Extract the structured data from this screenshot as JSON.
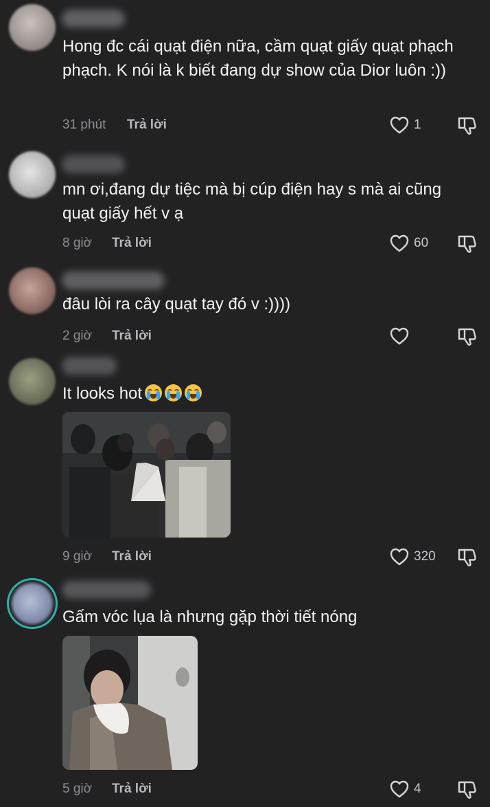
{
  "comments": [
    {
      "text": "Hong đc cái quạt điện nữa, cầm quạt giấy quạt phạch phạch. K nói là k biết đang dự show của Dior luôn :))",
      "time": "31 phút",
      "reply_label": "Trả lời",
      "likes": "1"
    },
    {
      "text": "mn ơi,đang dự tiệc mà bị cúp điện hay s mà ai cũng quạt giấy hết v ạ",
      "time": "8 giờ",
      "reply_label": "Trả lời",
      "likes": "60"
    },
    {
      "text": "đâu lòi ra cây quạt tay đó v :))))",
      "time": "2 giờ",
      "reply_label": "Trả lời",
      "likes": ""
    },
    {
      "text": "It looks hot",
      "time": "9 giờ",
      "reply_label": "Trả lời",
      "likes": "320",
      "emoji": "loudly-crying-face x3"
    },
    {
      "text": "Gấm vóc lụa là nhưng gặp thời tiết nóng",
      "time": "5 giờ",
      "reply_label": "Trả lời",
      "likes": "4"
    }
  ],
  "colors": {
    "background": "#222223",
    "text": "#f4f4f4",
    "meta": "#8d8d92",
    "reply": "#b7b7bc",
    "story_ring": "#2fb3a6"
  },
  "icons": [
    "heart-outline-icon",
    "thumb-down-icon",
    "loudly-crying-face-emoji"
  ]
}
